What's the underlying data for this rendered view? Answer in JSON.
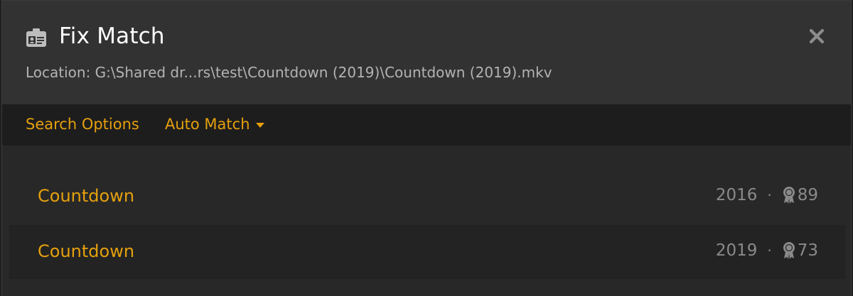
{
  "header": {
    "title": "Fix Match",
    "location": "Location: G:\\Shared dr...rs\\test\\Countdown (2019)\\Countdown (2019).mkv",
    "title_icon": "id-card-icon",
    "close_icon": "close-icon"
  },
  "toolbar": {
    "search_options_label": "Search Options",
    "auto_match_label": "Auto Match"
  },
  "results": [
    {
      "title": "Countdown",
      "year": "2016",
      "separator": "·",
      "score": "89"
    },
    {
      "title": "Countdown",
      "year": "2019",
      "separator": "·",
      "score": "73"
    }
  ],
  "colors": {
    "accent": "#e5a00d",
    "header_bg": "#323232",
    "toolbar_bg": "#1d1d1d",
    "body_bg": "#282828",
    "text_secondary": "#8a8a8a"
  }
}
